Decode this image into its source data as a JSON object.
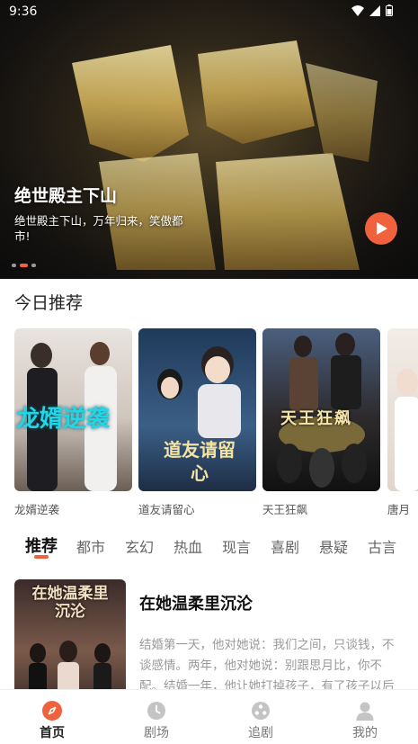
{
  "status_bar": {
    "time": "9:36"
  },
  "banner": {
    "title": "绝世殿主下山",
    "description": "绝世殿主下山，万年归来，笑傲都市!"
  },
  "section": {
    "title": "今日推荐"
  },
  "recommendations": [
    {
      "label": "龙婿逆袭",
      "poster_text": "龙婿逆袭"
    },
    {
      "label": "道友请留心",
      "poster_text": "道友请留心"
    },
    {
      "label": "天王狂飙",
      "poster_text": "天王狂飙"
    },
    {
      "label": "唐月",
      "poster_text": ""
    }
  ],
  "tabs": [
    "推荐",
    "都市",
    "玄幻",
    "热血",
    "现言",
    "喜剧",
    "悬疑",
    "古言"
  ],
  "feature": {
    "title": "在她温柔里沉沦",
    "poster_text": "在她温柔里沉沦",
    "description": "结婚第一天，他对她说：我们之间，只谈钱，不谈感情。两年，他对她说：别跟思月比，你不配。结婚一年，他让她打掉孩子，有了孩子以后不方便离婚。离婚时"
  },
  "bottom_nav": [
    {
      "label": "首页",
      "active": true
    },
    {
      "label": "剧场",
      "active": false
    },
    {
      "label": "追剧",
      "active": false
    },
    {
      "label": "我的",
      "active": false
    }
  ],
  "colors": {
    "accent": "#f0623d"
  }
}
